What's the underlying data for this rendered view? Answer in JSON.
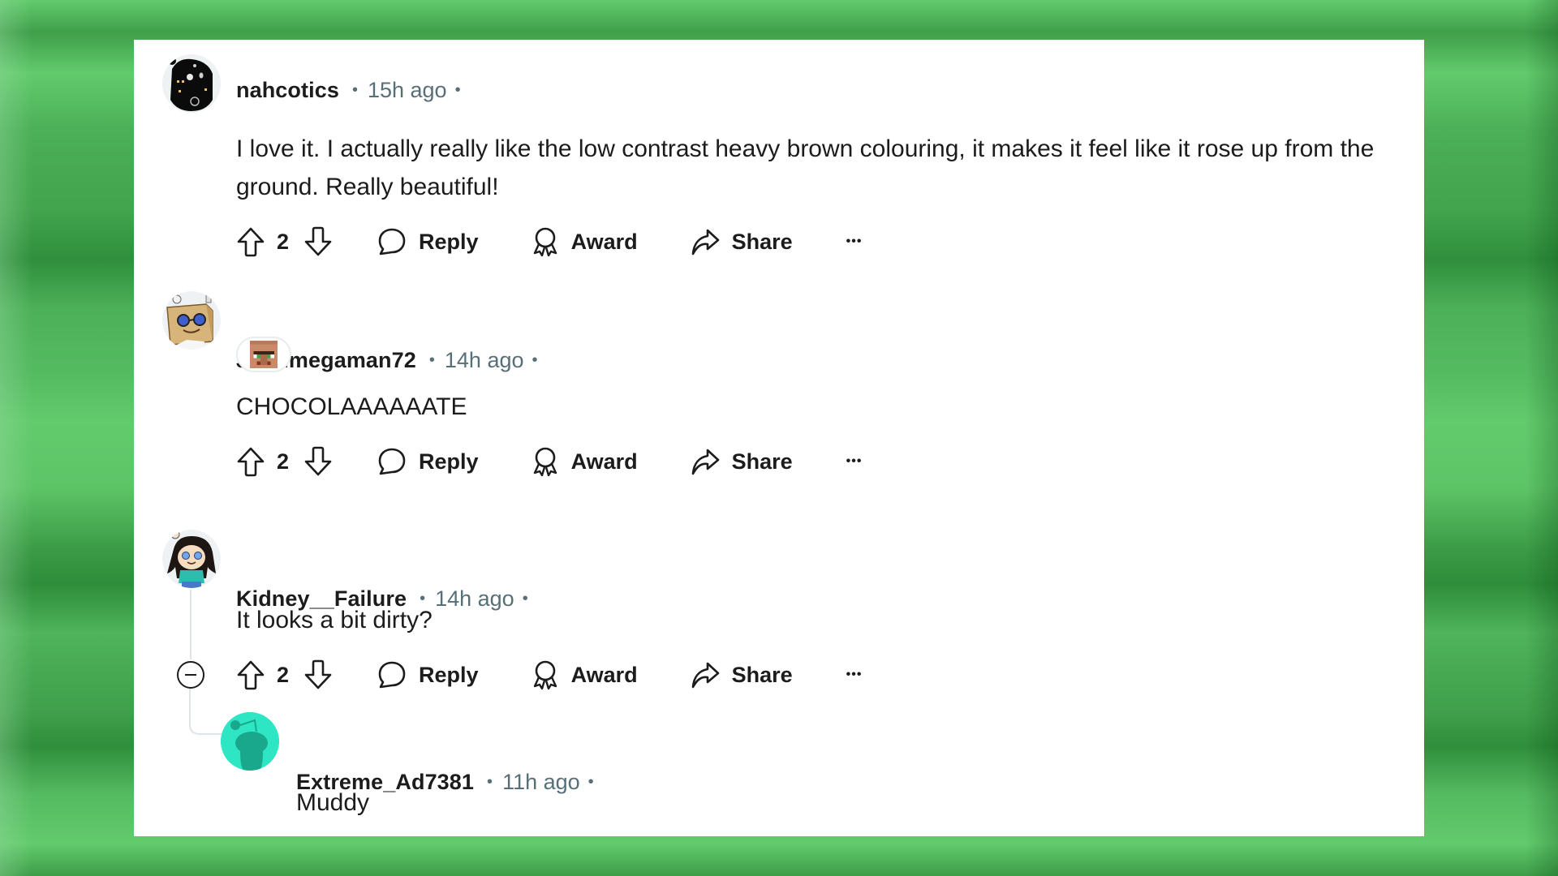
{
  "theme": {
    "background_green": "#5cc86a",
    "card_bg": "#ffffff",
    "text_primary": "#1c1c1c",
    "text_secondary": "#576f76",
    "reply_avatar_teal": "#2ee6c4"
  },
  "actions_labels": {
    "reply": "Reply",
    "award": "Award",
    "share": "Share",
    "more": "•••"
  },
  "comments": [
    {
      "username": "nahcotics",
      "timestamp": "15h ago",
      "avatar_icon": "dark-robot-avatar",
      "body": "I love it. I actually really like the low contrast heavy brown colouring, it makes it feel like it rose up from the ground. Really beautiful!",
      "votes": "2"
    },
    {
      "username": "Johnmegaman72",
      "timestamp": "14h ago",
      "avatar_icon": "cardboard-box-avatar",
      "flair_icon": "minecraft-villager-flair-icon",
      "body": "CHOCOLAAAAAATE",
      "votes": "2"
    },
    {
      "username": "Kidney__Failure",
      "timestamp": "14h ago",
      "avatar_icon": "cartoon-girl-avatar",
      "body": "It looks a bit dirty?",
      "votes": "2",
      "replies": [
        {
          "username": "Extreme_Ad7381",
          "timestamp": "11h ago",
          "avatar_icon": "snoo-default-avatar",
          "body": "Muddy"
        }
      ]
    }
  ]
}
